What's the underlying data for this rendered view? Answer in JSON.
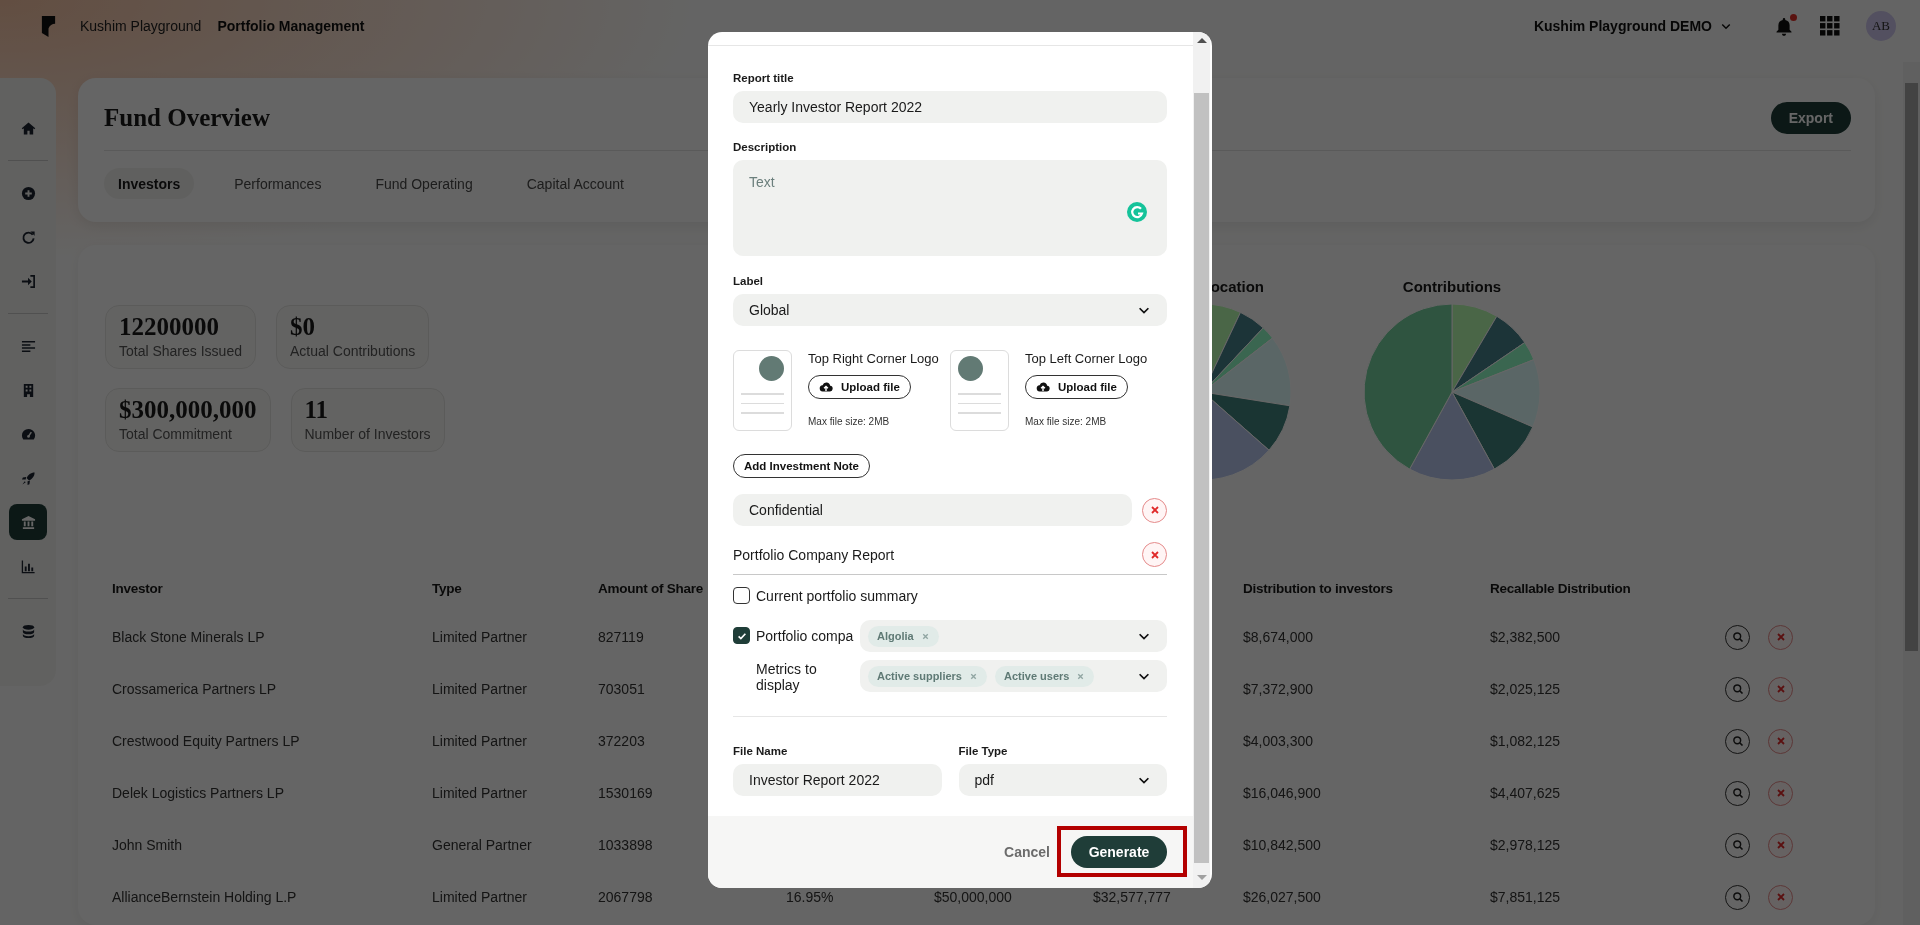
{
  "top_bar": {
    "workspace": "Kushim Playground",
    "section": "Portfolio Management",
    "account": "Kushim Playground DEMO",
    "notification_dot": true,
    "avatar": "AB"
  },
  "sidebar": {
    "groups": [
      [
        {
          "selected": false
        }
      ],
      [
        {
          "selected": false
        },
        {
          "selected": false
        },
        {
          "selected": false
        }
      ],
      [
        {
          "selected": false
        },
        {
          "selected": false
        },
        {
          "selected": false
        },
        {
          "selected": false
        },
        {
          "selected": true
        },
        {
          "selected": false
        }
      ],
      [
        {
          "selected": false
        }
      ]
    ]
  },
  "fund_overview": {
    "title": "Fund Overview",
    "export_button": "Export",
    "tabs": [
      {
        "label": "Investors",
        "selected": true
      },
      {
        "label": "Performances",
        "selected": false
      },
      {
        "label": "Fund Operating",
        "selected": false
      },
      {
        "label": "Capital Account",
        "selected": false
      }
    ]
  },
  "stats": [
    {
      "value": "12200000",
      "label": "Total Shares Issued"
    },
    {
      "value": "$0",
      "label": "Actual Contributions"
    },
    {
      "value": "$300,000,000",
      "label": "Total Commitment"
    },
    {
      "value": "11",
      "label": "Number of Investors"
    }
  ],
  "charts": [
    {
      "title": "ocation",
      "kind": "cut"
    },
    {
      "title": "Contributions",
      "kind": "full"
    }
  ],
  "table": {
    "headers": {
      "investor": "Investor",
      "type": "Type",
      "amount_of_shares": "Amount of Share",
      "distribution_to_investors": "Distribution to investors",
      "recallable_distribution": "Recallable Distribution"
    },
    "rows": [
      {
        "investor": "Black Stone Minerals LP",
        "type": "Limited Partner",
        "amount_of_shares": "827119",
        "distribution_to_investors": "$8,674,000",
        "recallable_distribution": "$2,382,500"
      },
      {
        "investor": "Crossamerica Partners LP",
        "type": "Limited Partner",
        "amount_of_shares": "703051",
        "distribution_to_investors": "$7,372,900",
        "recallable_distribution": "$2,025,125"
      },
      {
        "investor": "Crestwood Equity Partners LP",
        "type": "Limited Partner",
        "amount_of_shares": "372203",
        "distribution_to_investors": "$4,003,300",
        "recallable_distribution": "$1,082,125"
      },
      {
        "investor": "Delek Logistics Partners LP",
        "type": "Limited Partner",
        "amount_of_shares": "1530169",
        "distribution_to_investors": "$16,046,900",
        "recallable_distribution": "$4,407,625"
      },
      {
        "investor": "John Smith",
        "type": "General Partner",
        "amount_of_shares": "1033898",
        "distribution_to_investors": "$10,842,500",
        "recallable_distribution": "$2,978,125"
      },
      {
        "investor": "AllianceBernstein Holding L.P",
        "type": "Limited Partner",
        "amount_of_shares": "2067798",
        "column_4": "16.95%",
        "column_5": "$50,000,000",
        "column_6": "$32,577,777",
        "distribution_to_investors": "$26,027,500",
        "recallable_distribution": "$7,851,125"
      }
    ]
  },
  "report_dialog": {
    "report_title": {
      "label": "Report title",
      "value": "Yearly Investor Report 2022"
    },
    "description": {
      "label": "Description",
      "placeholder": "Text"
    },
    "label_select": {
      "label": "Label",
      "value": "Global"
    },
    "logos": [
      {
        "kind": "right",
        "title": "Top Right Corner Logo",
        "button": "Upload file",
        "hint": "Max file size: 2MB"
      },
      {
        "kind": "left",
        "title": "Top Left Corner Logo",
        "button": "Upload file",
        "hint": "Max file size: 2MB"
      }
    ],
    "add_note_button": "Add Investment Note",
    "notes": [
      {
        "kind": "field",
        "value": "Confidential"
      },
      {
        "kind": "section",
        "title": "Portfolio Company Report"
      }
    ],
    "options": [
      {
        "kind": "checkbox",
        "label": "Current portfolio summary",
        "checked": false
      },
      {
        "kind": "checkbox",
        "label": "Portfolio compa",
        "checked": true,
        "chips": [
          "Algolia"
        ]
      },
      {
        "kind": "select",
        "label": "Metrics to display",
        "chips": [
          "Active suppliers",
          "Active users"
        ]
      }
    ],
    "file_name": {
      "label": "File Name",
      "value": "Investor Report 2022"
    },
    "file_type": {
      "label": "File Type",
      "value": "pdf"
    },
    "cancel_button": "Cancel",
    "generate_button": {
      "label": "Generate",
      "highlighted": true
    }
  }
}
